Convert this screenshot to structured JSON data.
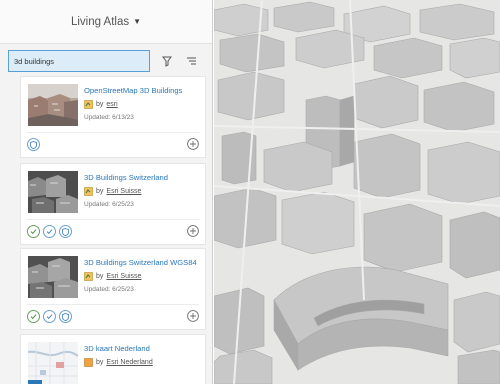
{
  "header": {
    "title": "Living Atlas"
  },
  "search": {
    "value": "3d buildings"
  },
  "results": [
    {
      "title": "OpenStreetMap 3D Buildings",
      "by": "by",
      "owner": "esri",
      "updated": "Updated: 6/13/23"
    },
    {
      "title": "3D Buildings Switzerland",
      "by": "by",
      "owner": "Esri Suisse",
      "updated": "Updated: 6/25/23"
    },
    {
      "title": "3D Buildings Switzerland WGS84",
      "by": "by",
      "owner": "Esri Suisse",
      "updated": "Updated: 6/25/23"
    },
    {
      "title": "3D kaart Nederland",
      "by": "by",
      "owner": "Esri Nederland"
    }
  ],
  "colors": {
    "accent": "#2a78b8",
    "search_bg": "#dcecf9",
    "panel_bg": "#f3f3f3",
    "building": "#c7c7c7"
  },
  "icons": [
    "caret-down-icon",
    "filter-icon",
    "sort-icon",
    "add-icon",
    "shield-icon",
    "check-icon",
    "owner-icon"
  ]
}
